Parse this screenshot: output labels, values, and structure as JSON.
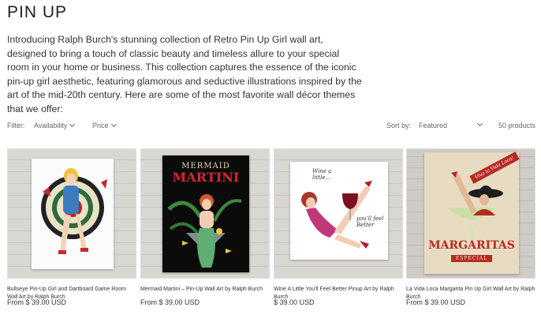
{
  "collection": {
    "title": "PIN UP",
    "description": "Introducing Ralph Burch's stunning collection of Retro Pin Up Girl wall art, designed to bring a touch of classic beauty and timeless allure to your special room in your home or business. This collection captures the essence of the iconic pin-up girl aesthetic, featuring glamorous and seductive illustrations inspired by the art of the mid-20th century. Here are some of the most favorite wall décor themes that we offer:"
  },
  "filters": {
    "label": "Filter:",
    "availability": "Availability",
    "price": "Price",
    "sort_label": "Sort by:",
    "sort_value": "Featured",
    "count": "50 products"
  },
  "products": [
    {
      "name": "Bullseye Pin-Up Girl and Dartboard Game Room Wall Art by Ralph Burch",
      "price": "From $ 39.00 USD",
      "image": "dartboard-pinup"
    },
    {
      "name": "Mermaid Martini – Pin-Up Wall Art by Ralph Burch",
      "price": "From $ 39.00 USD",
      "image": "mermaid-martini",
      "art_text_top": "MERMAID",
      "art_text_bottom": "MARTINI"
    },
    {
      "name": "Wine A Little You'll Feel Better Pinup Art by Ralph Burch",
      "price": "$ 39.00 USD",
      "image": "wine-pinup",
      "art_text_top": "Wine a little...",
      "art_text_bottom": "you'll feel Better"
    },
    {
      "name": "La Vida Loca Margarita Pin Up Girl Wall Art by Ralph Burch",
      "price": "From $ 39.00 USD",
      "image": "margarita-pinup",
      "art_text_top": "Viva la Vida Loca!",
      "art_text_bottom": "MARGARITAS",
      "art_text_sub": "ESPECIAL"
    }
  ],
  "colors": {
    "text": "#222222",
    "muted": "#666666",
    "wood": "#d9d7d2"
  }
}
